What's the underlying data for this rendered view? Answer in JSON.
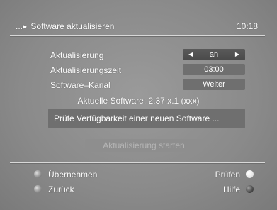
{
  "header": {
    "breadcrumb_prefix": "...",
    "title": "Software aktualisieren",
    "time": "10:18"
  },
  "settings": [
    {
      "label": "Aktualisierung",
      "value": "an",
      "selected": true
    },
    {
      "label": "Aktualisierungszeit",
      "value": "03:00"
    },
    {
      "label": "Software–Kanal",
      "value": "Weiter"
    }
  ],
  "current_software": "Aktuelle Software: 2.37.x.1 (xxx)",
  "status_message": "Prüfe Verfügbarkeit einer neuen Software ...",
  "start_button": "Aktualisierung starten",
  "footer": {
    "left": [
      {
        "label": "Übernehmen",
        "icon": "grey-button-icon"
      },
      {
        "label": "Zurück",
        "icon": "grey-button-icon"
      }
    ],
    "right": [
      {
        "label": "Prüfen",
        "icon": "white-button-icon"
      },
      {
        "label": "Hilfe",
        "icon": "dark-button-icon"
      }
    ]
  }
}
